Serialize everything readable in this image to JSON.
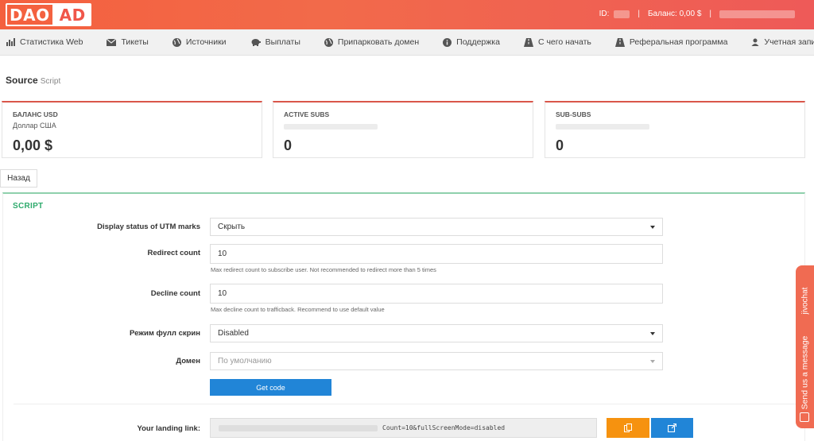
{
  "header": {
    "logo_left": "DAO",
    "logo_right": "AD",
    "id_label": "ID:",
    "balance_label": "Баланс: 0,00 $",
    "separator": "|"
  },
  "nav": [
    {
      "label": "Статистика Web",
      "icon": "bar-chart-icon"
    },
    {
      "label": "Тикеты",
      "icon": "envelope-icon"
    },
    {
      "label": "Источники",
      "icon": "globe-icon"
    },
    {
      "label": "Выплаты",
      "icon": "piggy-bank-icon"
    },
    {
      "label": "Припарковать домен",
      "icon": "globe-icon"
    },
    {
      "label": "Поддержка",
      "icon": "info-icon"
    },
    {
      "label": "С чего начать",
      "icon": "road-icon"
    },
    {
      "label": "Реферальная программа",
      "icon": "road-icon"
    },
    {
      "label": "Учетная запись",
      "icon": "user-icon"
    }
  ],
  "page": {
    "title": "Source",
    "subtitle": "Script",
    "back_label": "Назад"
  },
  "cards": [
    {
      "label": "БАЛАНС USD",
      "sub": "Доллар США",
      "value": "0,00 $"
    },
    {
      "label": "ACTIVE SUBS",
      "sub": "",
      "value": "0"
    },
    {
      "label": "SUB-SUBS",
      "sub": "",
      "value": "0"
    }
  ],
  "panel": {
    "title": "SCRIPT",
    "utm_label": "Display status of UTM marks",
    "utm_value": "Скрыть",
    "redirect_label": "Redirect count",
    "redirect_value": "10",
    "redirect_help": "Max redirect count to subscribe user. Not recommended to redirect more than 5 times",
    "decline_label": "Decline count",
    "decline_value": "10",
    "decline_help": "Max decline count to trafficback. Recommend to use default value",
    "fullscreen_label": "Режим фулл скрин",
    "fullscreen_value": "Disabled",
    "domain_label": "Домен",
    "domain_placeholder": "По умолчанию",
    "get_code_label": "Get code",
    "landing_label": "Your landing link:",
    "landing_value": "Count=10&fullScreenMode=disabled"
  },
  "jivo": {
    "brand": "jivochat",
    "message": "Send us a message"
  },
  "colors": {
    "header": "#f26a4a",
    "card_accent": "#d9564a",
    "panel_accent": "#8fd0ac",
    "primary_button": "#2185d7",
    "copy_button": "#f6920f"
  }
}
